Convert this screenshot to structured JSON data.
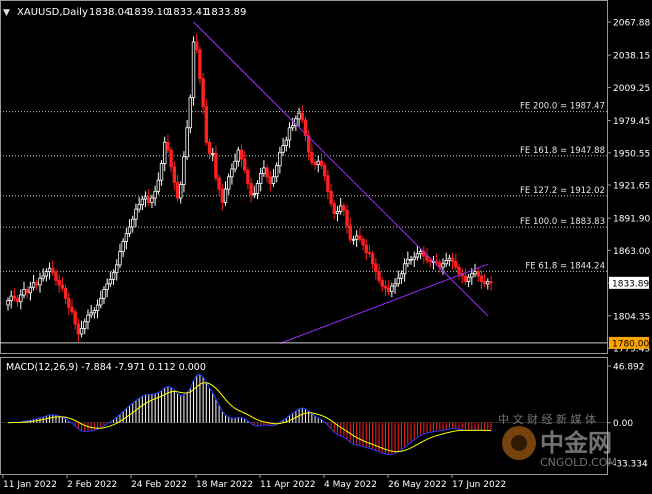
{
  "header": {
    "menu_glyph": "▼",
    "symbol_label": "XAUUSD,Daily",
    "ohlc": [
      "1838.04",
      "1839.10",
      "1833.41",
      "1833.89"
    ]
  },
  "price_axis": {
    "ticks": [
      "2067.88",
      "2038.15",
      "2009.25",
      "1979.45",
      "1950.55",
      "1921.65",
      "1891.90",
      "1863.00",
      "1833.89",
      "1804.35",
      "1775.45"
    ],
    "current_price": "1833.89",
    "marker_price": "1780.00"
  },
  "fib_levels": [
    {
      "label": "FE 200.0 = 1987.47",
      "price": 1987.47
    },
    {
      "label": "FE 161.8 = 1947.88",
      "price": 1947.88
    },
    {
      "label": "FE 127.2 = 1912.02",
      "price": 1912.02
    },
    {
      "label": "FE 100.0 = 1883.83",
      "price": 1883.83
    },
    {
      "label": "FE 61.8 = 1844.24",
      "price": 1844.24
    }
  ],
  "macd": {
    "label": "MACD(12,26,9) -7.884 -7.971 0.112 0.000",
    "axis_ticks": [
      "46.892",
      "0.00",
      "-33.334"
    ]
  },
  "time_axis": [
    "11 Jan 2022",
    "2 Feb 2022",
    "24 Feb 2022",
    "18 Mar 2022",
    "11 Apr 2022",
    "4 May 2022",
    "26 May 2022",
    "17 Jun 2022"
  ],
  "watermark": {
    "brand": "中金网",
    "site": "CNGOLD.COM",
    "tagline": "中 文 财 经 新 媒 体"
  },
  "colors": {
    "background": "#000000",
    "bull": "#ffffff",
    "bear": "#ff2020",
    "trendline": "#9b30ff",
    "fib_line": "#c8c8c8",
    "signal": "#ffff00",
    "macd_line": "#1e3cff"
  },
  "chart_data": {
    "type": "candlestick",
    "symbol": "XAUUSD",
    "timeframe": "Daily",
    "ylim": [
      1775.45,
      2067.88
    ],
    "closes": [
      1818,
      1822,
      1820,
      1817,
      1823,
      1828,
      1825,
      1830,
      1834,
      1832,
      1838,
      1840,
      1844,
      1847,
      1843,
      1836,
      1832,
      1829,
      1820,
      1812,
      1808,
      1797,
      1788,
      1793,
      1799,
      1805,
      1807,
      1809,
      1814,
      1820,
      1828,
      1833,
      1837,
      1843,
      1850,
      1862,
      1871,
      1878,
      1884,
      1891,
      1900,
      1904,
      1909,
      1911,
      1906,
      1910,
      1916,
      1926,
      1941,
      1960,
      1953,
      1938,
      1924,
      1910,
      1922,
      1947,
      1973,
      2000,
      2050,
      2043,
      2017,
      1992,
      1960,
      1950,
      1950,
      1928,
      1918,
      1906,
      1918,
      1929,
      1936,
      1943,
      1953,
      1945,
      1935,
      1923,
      1913,
      1914,
      1923,
      1932,
      1937,
      1929,
      1923,
      1929,
      1939,
      1951,
      1957,
      1962,
      1973,
      1975,
      1981,
      1986,
      1980,
      1966,
      1951,
      1942,
      1940,
      1943,
      1939,
      1930,
      1916,
      1905,
      1896,
      1898,
      1903,
      1899,
      1885,
      1873,
      1873,
      1876,
      1873,
      1868,
      1861,
      1860,
      1851,
      1844,
      1836,
      1831,
      1829,
      1826,
      1831,
      1833,
      1838,
      1842,
      1851,
      1855,
      1855,
      1857,
      1860,
      1862,
      1858,
      1854,
      1853,
      1853,
      1852,
      1848,
      1851,
      1854,
      1856,
      1853,
      1848,
      1842,
      1840,
      1835,
      1839,
      1842,
      1844,
      1840,
      1835,
      1833,
      1835,
      1834
    ],
    "trendlines": [
      {
        "name": "",
        "from": [
          58,
          2067.88
        ],
        "to": [
          150,
          1804.35
        ]
      },
      {
        "name": "",
        "from": [
          85,
          1779.5
        ],
        "to": [
          150,
          1850.5
        ]
      }
    ],
    "horizontal_levels": [
      1987.47,
      1947.88,
      1912.02,
      1883.83,
      1844.24,
      1780.0
    ],
    "macd_params": [
      12,
      26,
      9
    ],
    "macd_values": {
      "main": -7.884,
      "signal": -7.971,
      "third": 0.112,
      "fourth": 0.0
    },
    "macd_ylim": [
      -33.334,
      46.892
    ]
  }
}
